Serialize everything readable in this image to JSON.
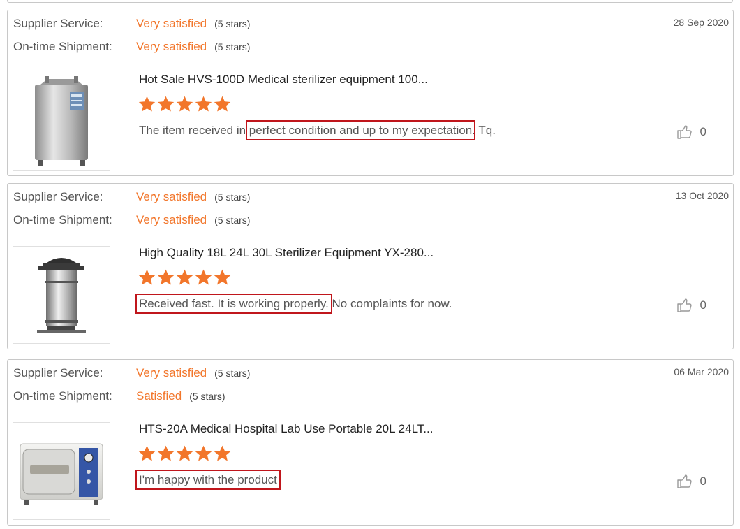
{
  "labels": {
    "supplier_service": "Supplier Service:",
    "on_time_shipment": "On-time Shipment:"
  },
  "colors": {
    "accent": "#f2762b",
    "highlight_box": "#c0161c"
  },
  "icons": {
    "star": "star-icon",
    "like": "thumbs-up-icon"
  },
  "reviews": [
    {
      "date": "28 Sep 2020",
      "supplier_service": {
        "value": "Very satisfied",
        "stars_text": "(5 stars)"
      },
      "on_time_shipment": {
        "value": "Very satisfied",
        "stars_text": "(5 stars)"
      },
      "product_title": "Hot Sale HVS-100D Medical sterilizer equipment 100...",
      "rating": 5,
      "text_before": "The item received in ",
      "text_highlight": "perfect condition and up to my expectation",
      "text_after": ". Tq.",
      "likes": "0"
    },
    {
      "date": "13 Oct 2020",
      "supplier_service": {
        "value": "Very satisfied",
        "stars_text": "(5 stars)"
      },
      "on_time_shipment": {
        "value": "Very satisfied",
        "stars_text": "(5 stars)"
      },
      "product_title": "High Quality 18L 24L 30L Sterilizer Equipment YX-280...",
      "rating": 5,
      "text_before": "",
      "text_highlight": "Received fast. It is working properly.",
      "text_after": " No complaints for now.",
      "likes": "0"
    },
    {
      "date": "06 Mar 2020",
      "supplier_service": {
        "value": "Very satisfied",
        "stars_text": "(5 stars)"
      },
      "on_time_shipment": {
        "value": "Satisfied",
        "stars_text": "(5 stars)"
      },
      "product_title": "HTS-20A Medical Hospital Lab Use Portable 20L 24LT...",
      "rating": 5,
      "text_before": "",
      "text_highlight": "I'm happy with the product",
      "text_after": "",
      "likes": "0"
    }
  ]
}
